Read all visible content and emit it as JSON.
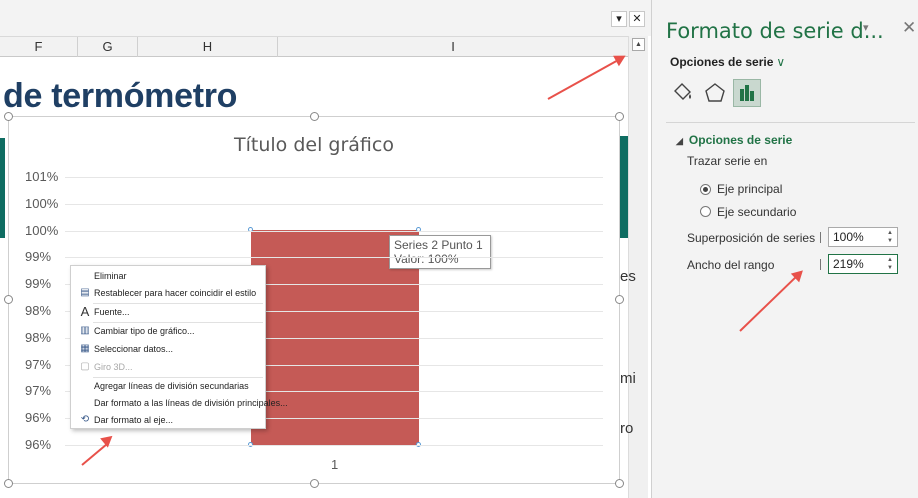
{
  "toolbar": {
    "dropdown_btn": "▾",
    "close_btn": "✕"
  },
  "columns": [
    "F",
    "G",
    "H",
    "I"
  ],
  "sheet": {
    "title_fragment": "de termómetro",
    "right_edge_fragments": [
      "es",
      "mi",
      "ro"
    ]
  },
  "chart": {
    "title": "Título del gráfico",
    "ytick_labels": [
      "101%",
      "100%",
      "100%",
      "99%",
      "99%",
      "98%",
      "98%",
      "97%",
      "97%",
      "96%",
      "96%"
    ],
    "category": "1",
    "tooltip": {
      "line1": "Series 2 Punto 1",
      "line2": "Valor: 100%"
    }
  },
  "chart_data": {
    "type": "bar",
    "title": "Título del gráfico",
    "categories": [
      "1"
    ],
    "series": [
      {
        "values": [
          1.0
        ]
      }
    ],
    "ylim": [
      0.96,
      1.01
    ],
    "grid": true
  },
  "context_menu": {
    "items": [
      {
        "label": "Eliminar",
        "icon": "",
        "disabled": false
      },
      {
        "label": "Restablecer para hacer coincidir el estilo",
        "icon": "reset-style-icon",
        "disabled": false
      },
      {
        "label": "Fuente...",
        "icon": "font-icon",
        "disabled": false
      },
      {
        "label": "Cambiar tipo de gráfico...",
        "icon": "chart-type-icon",
        "disabled": false
      },
      {
        "label": "Seleccionar datos...",
        "icon": "select-data-icon",
        "disabled": false
      },
      {
        "label": "Giro 3D...",
        "icon": "rotate-3d-icon",
        "disabled": true
      },
      {
        "label": "Agregar líneas de división secundarias",
        "icon": "",
        "disabled": false
      },
      {
        "label": "Dar formato a las líneas de división principales...",
        "icon": "",
        "disabled": false
      },
      {
        "label": "Dar formato al eje...",
        "icon": "format-axis-icon",
        "disabled": false
      }
    ]
  },
  "pane": {
    "title": "Formato de serie d...",
    "pin": "▾",
    "close": "✕",
    "series_dropdown": "Opciones de serie",
    "series_dropdown_chevron": "∨",
    "section_title": "Opciones de serie",
    "section_toggle": "◢",
    "plot_on": "Trazar serie en",
    "radio_primary": "Eje principal",
    "radio_secondary": "Eje secundario",
    "overlap_label": "Superposición de series",
    "overlap_value": "100%",
    "gap_label": "Ancho del rango",
    "gap_value": "219%",
    "colors": {
      "accent": "#217346",
      "bar": "#c55a56",
      "arrow": "#e8514a"
    }
  }
}
